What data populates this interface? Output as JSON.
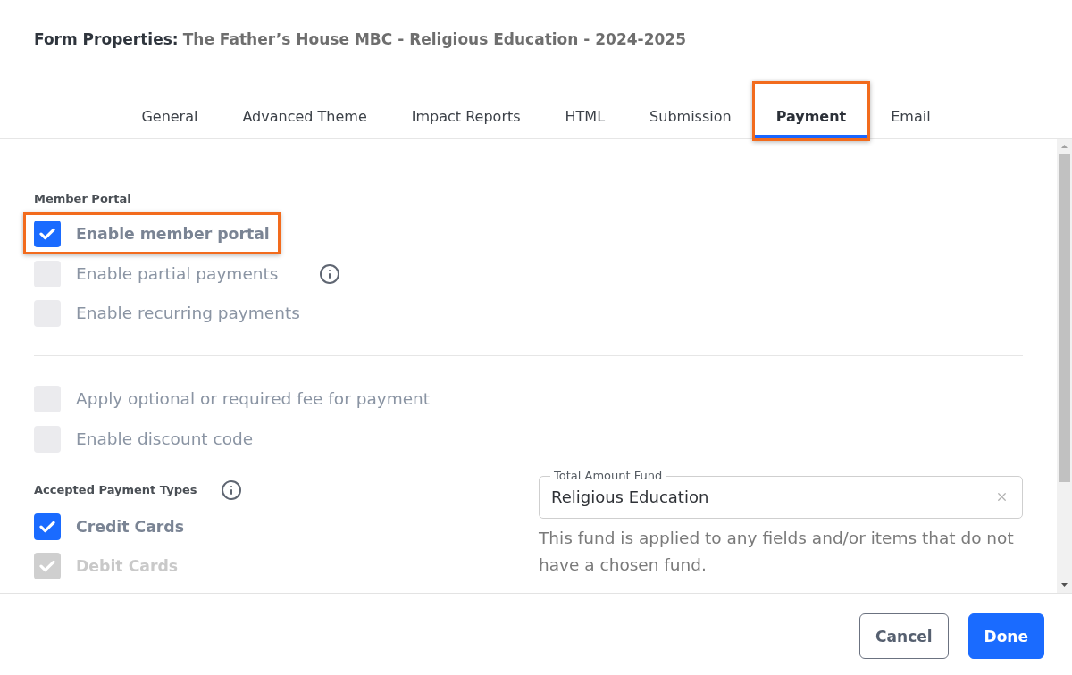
{
  "dialog": {
    "title_label": "Form Properties:",
    "form_name": "The Father’s House MBC - Religious Education - 2024-2025"
  },
  "tabs": [
    {
      "label": "General",
      "selected": false,
      "highlighted": false
    },
    {
      "label": "Advanced Theme",
      "selected": false,
      "highlighted": false
    },
    {
      "label": "Impact Reports",
      "selected": false,
      "highlighted": false
    },
    {
      "label": "HTML",
      "selected": false,
      "highlighted": false
    },
    {
      "label": "Submission",
      "selected": false,
      "highlighted": false
    },
    {
      "label": "Payment",
      "selected": true,
      "highlighted": true
    },
    {
      "label": "Email",
      "selected": false,
      "highlighted": false
    }
  ],
  "member_portal": {
    "heading": "Member Portal",
    "options": [
      {
        "label": "Enable member portal",
        "checked": true,
        "highlighted": true,
        "info": false
      },
      {
        "label": "Enable partial payments",
        "checked": false,
        "highlighted": false,
        "info": true
      },
      {
        "label": "Enable recurring payments",
        "checked": false,
        "highlighted": false,
        "info": false
      }
    ]
  },
  "fee_options": [
    {
      "label": "Apply optional or required fee for payment",
      "checked": false
    },
    {
      "label": "Enable discount code",
      "checked": false
    }
  ],
  "payment_types": {
    "heading": "Accepted Payment Types",
    "info": true,
    "options": [
      {
        "label": "Credit Cards",
        "checked": true,
        "disabled": false
      },
      {
        "label": "Debit Cards",
        "checked": true,
        "disabled": true
      }
    ]
  },
  "fund_field": {
    "label": "Total Amount Fund",
    "value": "Religious Education",
    "help": "This fund is applied to any fields and/or items that do not have a chosen fund."
  },
  "buttons": [
    {
      "label": "Cancel",
      "kind": "secondary"
    },
    {
      "label": "Done",
      "kind": "primary"
    }
  ]
}
